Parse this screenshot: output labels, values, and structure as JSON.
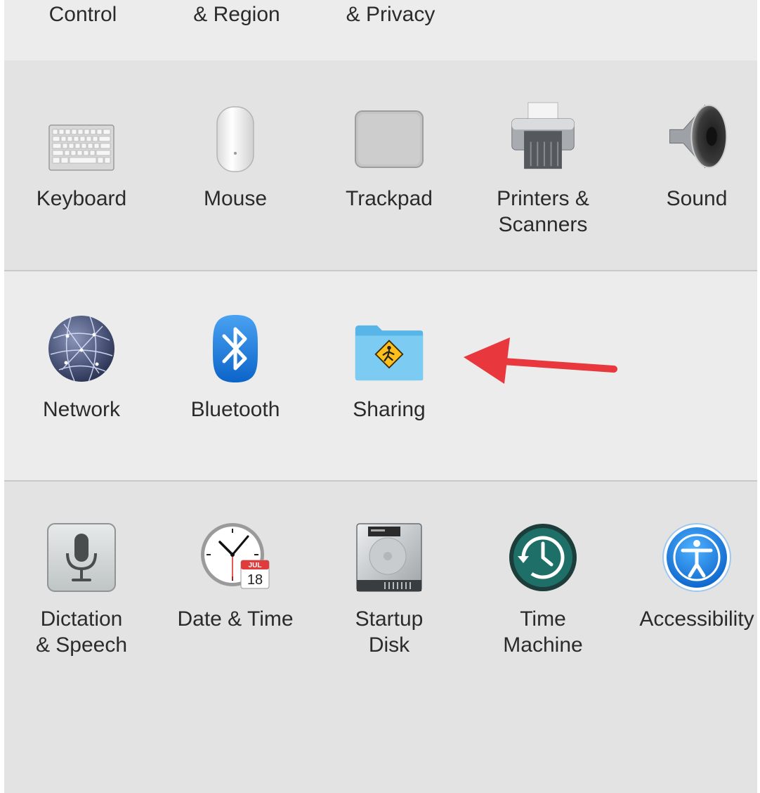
{
  "top_row": [
    {
      "label": "Control"
    },
    {
      "label": "& Region"
    },
    {
      "label": "& Privacy"
    }
  ],
  "hardware": [
    {
      "label": "Keyboard",
      "icon": "keyboard-icon"
    },
    {
      "label": "Mouse",
      "icon": "mouse-icon"
    },
    {
      "label": "Trackpad",
      "icon": "trackpad-icon"
    },
    {
      "label": "Printers &\nScanners",
      "icon": "printer-icon"
    },
    {
      "label": "Sound",
      "icon": "speaker-icon"
    }
  ],
  "internet": [
    {
      "label": "Network",
      "icon": "globe-icon"
    },
    {
      "label": "Bluetooth",
      "icon": "bluetooth-icon"
    },
    {
      "label": "Sharing",
      "icon": "sharing-folder-icon"
    }
  ],
  "system": [
    {
      "label": "Dictation\n& Speech",
      "icon": "microphone-icon"
    },
    {
      "label": "Date & Time",
      "icon": "clock-icon",
      "calendar_month": "JUL",
      "calendar_day": "18"
    },
    {
      "label": "Startup\nDisk",
      "icon": "hard-disk-icon"
    },
    {
      "label": "Time\nMachine",
      "icon": "time-machine-icon"
    },
    {
      "label": "Accessibility",
      "icon": "accessibility-icon"
    }
  ],
  "annotation": {
    "color": "#e8383d",
    "icon": "red-arrow-icon"
  }
}
